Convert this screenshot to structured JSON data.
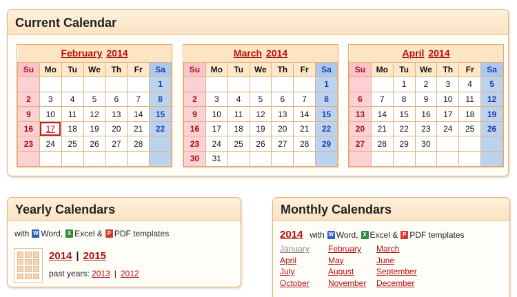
{
  "current": {
    "title": "Current Calendar",
    "dow": [
      "Su",
      "Mo",
      "Tu",
      "We",
      "Th",
      "Fr",
      "Sa"
    ],
    "months": [
      {
        "name": "February",
        "year": "2014",
        "today": "17",
        "weeks": [
          [
            "",
            "",
            "",
            "",
            "",
            "",
            "1"
          ],
          [
            "2",
            "3",
            "4",
            "5",
            "6",
            "7",
            "8"
          ],
          [
            "9",
            "10",
            "11",
            "12",
            "13",
            "14",
            "15"
          ],
          [
            "16",
            "17",
            "18",
            "19",
            "20",
            "21",
            "22"
          ],
          [
            "23",
            "24",
            "25",
            "26",
            "27",
            "28",
            ""
          ],
          [
            "",
            "",
            "",
            "",
            "",
            "",
            ""
          ]
        ]
      },
      {
        "name": "March",
        "year": "2014",
        "today": "",
        "weeks": [
          [
            "",
            "",
            "",
            "",
            "",
            "",
            "1"
          ],
          [
            "2",
            "3",
            "4",
            "5",
            "6",
            "7",
            "8"
          ],
          [
            "9",
            "10",
            "11",
            "12",
            "13",
            "14",
            "15"
          ],
          [
            "16",
            "17",
            "18",
            "19",
            "20",
            "21",
            "22"
          ],
          [
            "23",
            "24",
            "25",
            "26",
            "27",
            "28",
            "29"
          ],
          [
            "30",
            "31",
            "",
            "",
            "",
            "",
            ""
          ]
        ]
      },
      {
        "name": "April",
        "year": "2014",
        "today": "",
        "weeks": [
          [
            "",
            "",
            "1",
            "2",
            "3",
            "4",
            "5"
          ],
          [
            "6",
            "7",
            "8",
            "9",
            "10",
            "11",
            "12"
          ],
          [
            "13",
            "14",
            "15",
            "16",
            "17",
            "18",
            "19"
          ],
          [
            "20",
            "21",
            "22",
            "23",
            "24",
            "25",
            "26"
          ],
          [
            "27",
            "28",
            "29",
            "30",
            "",
            "",
            ""
          ],
          [
            "",
            "",
            "",
            "",
            "",
            "",
            ""
          ]
        ]
      }
    ]
  },
  "yearly": {
    "title": "Yearly Calendars",
    "with": "with",
    "word": "Word,",
    "excel": "Excel &",
    "pdf": "PDF templates",
    "year1": "2014",
    "sep": "|",
    "year2": "2015",
    "past_label": "past years:",
    "past1": "2013",
    "past2": "2012"
  },
  "monthly": {
    "title": "Monthly Calendars",
    "year": "2014",
    "with": "with",
    "word": "Word,",
    "excel": "Excel &",
    "pdf": "PDF templates",
    "months": [
      "January",
      "February",
      "March",
      "April",
      "May",
      "June",
      "July",
      "August",
      "September",
      "October",
      "November",
      "December"
    ]
  },
  "icons": {
    "word": "W",
    "excel": "X",
    "pdf": "P"
  },
  "colors": {
    "accent": "#b01010",
    "sunday_bg": "#fcd0d5",
    "saturday_bg": "#bcd3f0",
    "header_bg": "#fbe3c2"
  }
}
